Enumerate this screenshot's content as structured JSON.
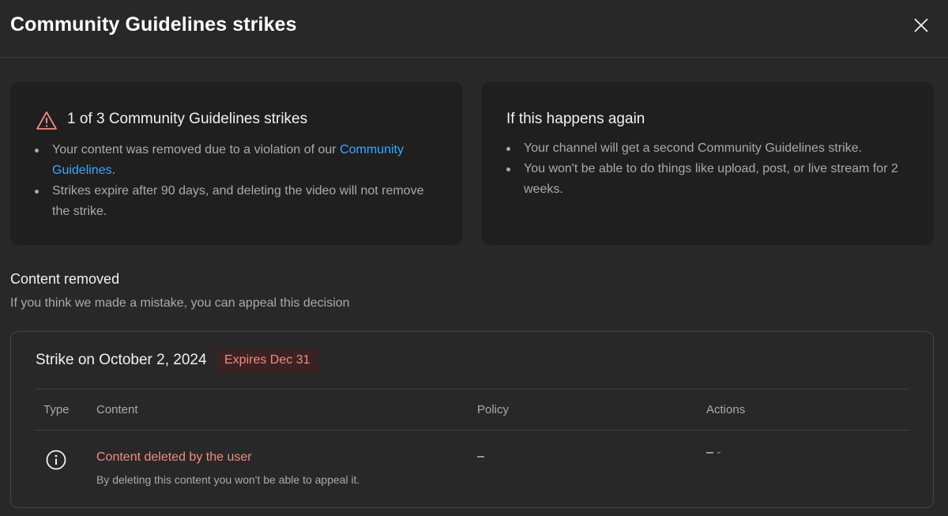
{
  "dialog": {
    "title": "Community Guidelines strikes",
    "close_icon": "close-icon"
  },
  "strike_summary": {
    "heading": "1 of 3 Community Guidelines strikes",
    "icon": "warning-triangle-icon",
    "icon_color": "#f28b82",
    "bullet1_prefix": "Your content was removed due to a violation of our ",
    "bullet1_link": "Community Guidelines",
    "bullet1_suffix": ".",
    "bullet2": "Strikes expire after 90 days, and deleting the video will not remove the strike."
  },
  "consequences": {
    "heading": "If this happens again",
    "bullets": [
      "Your channel will get a second Community Guidelines strike.",
      "You won't be able to do things like upload, post, or live stream for 2 weeks."
    ]
  },
  "content_removed": {
    "title": "Content removed",
    "subtitle": "If you think we made a mistake, you can appeal this decision"
  },
  "strike": {
    "title": "Strike on October 2, 2024",
    "expires_badge": "Expires Dec 31",
    "badge_color": "#f28b82",
    "columns": [
      "Type",
      "Content",
      "Policy",
      "Actions"
    ],
    "row": {
      "type_icon": "info-icon",
      "content_title": "Content deleted by the user",
      "content_desc": "By deleting this content you won't be able to appeal it.",
      "policy": "–",
      "actions_primary": "–",
      "actions_secondary": "-"
    }
  },
  "colors": {
    "background": "#282828",
    "card": "#1f1f1f",
    "link": "#3ea6ff",
    "alert": "#f28b82"
  }
}
